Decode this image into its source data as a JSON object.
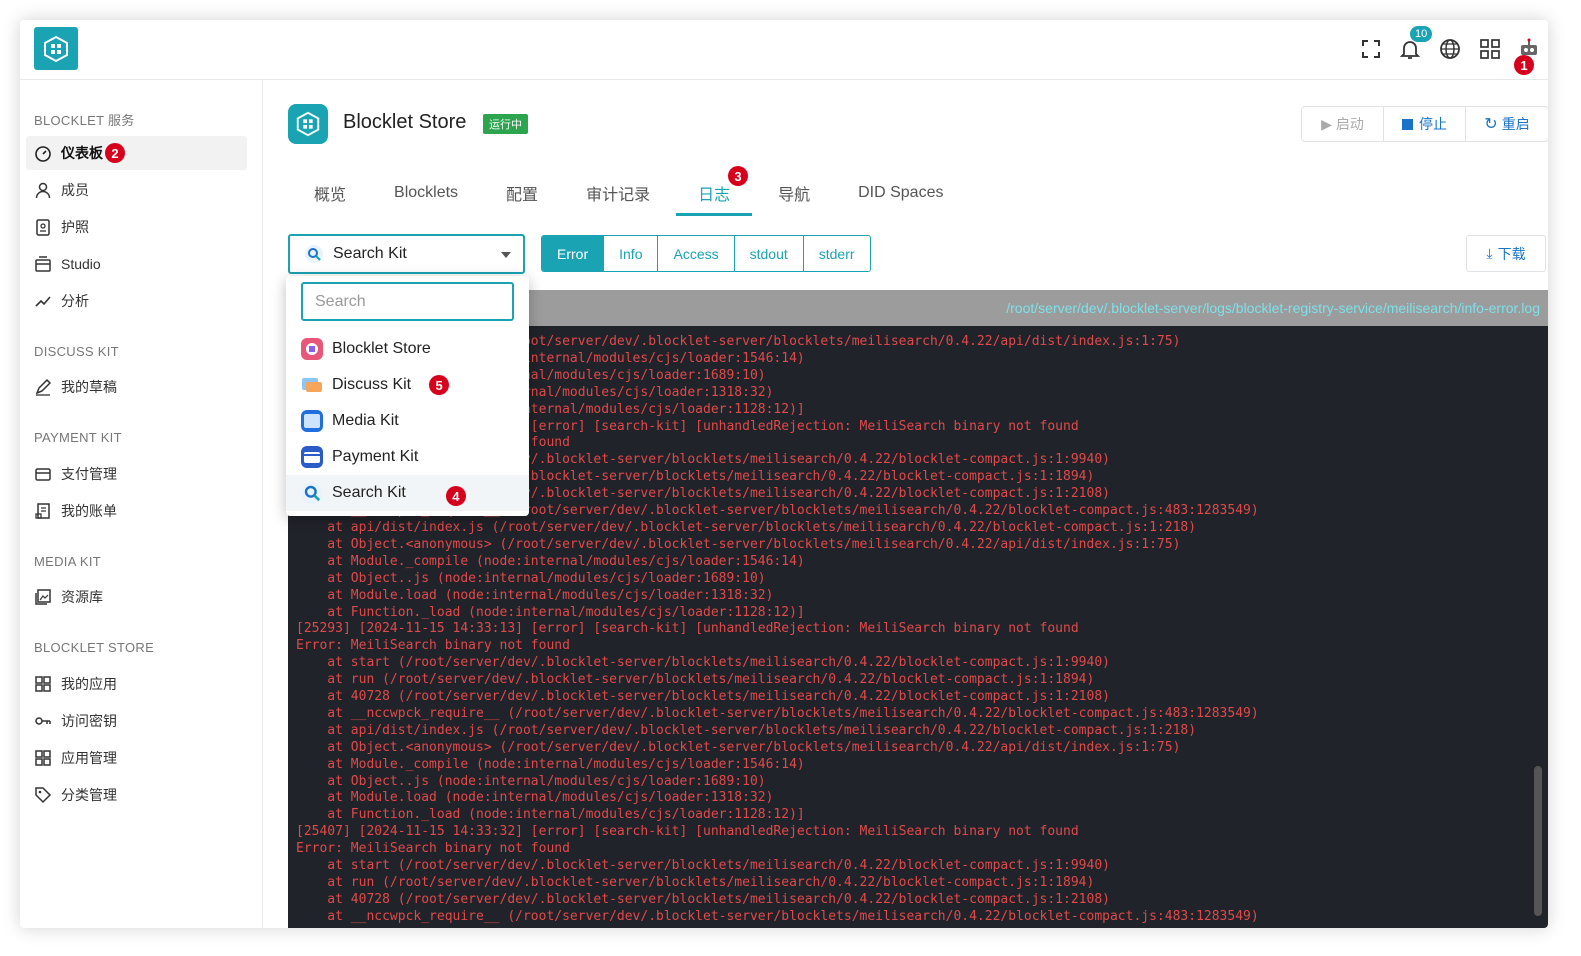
{
  "header": {
    "notification_count": "10",
    "markers": {
      "m1": "1",
      "m2": "2",
      "m3": "3",
      "m4": "4",
      "m5": "5"
    }
  },
  "sidebar": {
    "sections": [
      {
        "title": "BLOCKLET 服务",
        "items": [
          {
            "label": "仪表板",
            "icon": "dashboard-icon"
          },
          {
            "label": "成员",
            "icon": "user-icon"
          },
          {
            "label": "护照",
            "icon": "passport-icon"
          },
          {
            "label": "Studio",
            "icon": "studio-icon"
          },
          {
            "label": "分析",
            "icon": "analytics-icon"
          }
        ]
      },
      {
        "title": "DISCUSS KIT",
        "items": [
          {
            "label": "我的草稿",
            "icon": "draft-icon"
          }
        ]
      },
      {
        "title": "PAYMENT KIT",
        "items": [
          {
            "label": "支付管理",
            "icon": "payment-icon"
          },
          {
            "label": "我的账单",
            "icon": "bill-icon"
          }
        ]
      },
      {
        "title": "MEDIA KIT",
        "items": [
          {
            "label": "资源库",
            "icon": "library-icon"
          }
        ]
      },
      {
        "title": "BLOCKLET STORE",
        "items": [
          {
            "label": "我的应用",
            "icon": "apps-icon"
          },
          {
            "label": "访问密钥",
            "icon": "key-icon"
          },
          {
            "label": "应用管理",
            "icon": "apps-icon"
          },
          {
            "label": "分类管理",
            "icon": "tag-icon"
          }
        ]
      }
    ]
  },
  "app": {
    "title": "Blocklet Store",
    "status": "运行中",
    "actions": {
      "start": "启动",
      "stop": "停止",
      "restart": "重启"
    }
  },
  "tabs": [
    "概览",
    "Blocklets",
    "配置",
    "审计记录",
    "日志",
    "导航",
    "DID Spaces"
  ],
  "active_tab": "日志",
  "log_source": {
    "selected": "Search Kit",
    "search_placeholder": "Search",
    "options": [
      "Blocklet Store",
      "Discuss Kit",
      "Media Kit",
      "Payment Kit",
      "Search Kit"
    ]
  },
  "log_types": [
    "Error",
    "Info",
    "Access",
    "stdout",
    "stderr"
  ],
  "active_log_type": "Error",
  "download_label": "下载",
  "log_path": "/root/server/dev/.blocklet-server/logs/blocklet-registry-service/meilisearch/info-error.log",
  "log_lines": [
    "    at Object.<anonymous> (/root/server/dev/.blocklet-server/blocklets/meilisearch/0.4.22/api/dist/index.js:1:75)",
    "    at Module._compile (node:internal/modules/cjs/loader:1546:14)",
    "    at Object..js (node:internal/modules/cjs/loader:1689:10)",
    "    at Module.load (node:internal/modules/cjs/loader:1318:32)",
    "    at Function._load (node:internal/modules/cjs/loader:1128:12)]",
    "[25155] [2024-11-15 14:32:55] [error] [search-kit] [unhandledRejection: MeiliSearch binary not found",
    "Error: MeiliSearch binary not found",
    "    at start (/root/server/dev/.blocklet-server/blocklets/meilisearch/0.4.22/blocklet-compact.js:1:9940)",
    "    at run (/root/server/dev/.blocklet-server/blocklets/meilisearch/0.4.22/blocklet-compact.js:1:1894)",
    "    at 40728 (/root/server/dev/.blocklet-server/blocklets/meilisearch/0.4.22/blocklet-compact.js:1:2108)",
    "    at __nccwpck_require__ (/root/server/dev/.blocklet-server/blocklets/meilisearch/0.4.22/blocklet-compact.js:483:1283549)",
    "    at api/dist/index.js (/root/server/dev/.blocklet-server/blocklets/meilisearch/0.4.22/blocklet-compact.js:1:218)",
    "    at Object.<anonymous> (/root/server/dev/.blocklet-server/blocklets/meilisearch/0.4.22/api/dist/index.js:1:75)",
    "    at Module._compile (node:internal/modules/cjs/loader:1546:14)",
    "    at Object..js (node:internal/modules/cjs/loader:1689:10)",
    "    at Module.load (node:internal/modules/cjs/loader:1318:32)",
    "    at Function._load (node:internal/modules/cjs/loader:1128:12)]",
    "[25293] [2024-11-15 14:33:13] [error] [search-kit] [unhandledRejection: MeiliSearch binary not found",
    "Error: MeiliSearch binary not found",
    "    at start (/root/server/dev/.blocklet-server/blocklets/meilisearch/0.4.22/blocklet-compact.js:1:9940)",
    "    at run (/root/server/dev/.blocklet-server/blocklets/meilisearch/0.4.22/blocklet-compact.js:1:1894)",
    "    at 40728 (/root/server/dev/.blocklet-server/blocklets/meilisearch/0.4.22/blocklet-compact.js:1:2108)",
    "    at __nccwpck_require__ (/root/server/dev/.blocklet-server/blocklets/meilisearch/0.4.22/blocklet-compact.js:483:1283549)",
    "    at api/dist/index.js (/root/server/dev/.blocklet-server/blocklets/meilisearch/0.4.22/blocklet-compact.js:1:218)",
    "    at Object.<anonymous> (/root/server/dev/.blocklet-server/blocklets/meilisearch/0.4.22/api/dist/index.js:1:75)",
    "    at Module._compile (node:internal/modules/cjs/loader:1546:14)",
    "    at Object..js (node:internal/modules/cjs/loader:1689:10)",
    "    at Module.load (node:internal/modules/cjs/loader:1318:32)",
    "    at Function._load (node:internal/modules/cjs/loader:1128:12)]",
    "[25407] [2024-11-15 14:33:32] [error] [search-kit] [unhandledRejection: MeiliSearch binary not found",
    "Error: MeiliSearch binary not found",
    "    at start (/root/server/dev/.blocklet-server/blocklets/meilisearch/0.4.22/blocklet-compact.js:1:9940)",
    "    at run (/root/server/dev/.blocklet-server/blocklets/meilisearch/0.4.22/blocklet-compact.js:1:1894)",
    "    at 40728 (/root/server/dev/.blocklet-server/blocklets/meilisearch/0.4.22/blocklet-compact.js:1:2108)",
    "    at __nccwpck_require__ (/root/server/dev/.blocklet-server/blocklets/meilisearch/0.4.22/blocklet-compact.js:483:1283549)"
  ],
  "colors": {
    "accent": "#1aa3b3",
    "status_green": "#2da44e",
    "marker_red": "#d6001c",
    "log_bg": "#21232a",
    "log_text": "#e04a4a"
  }
}
